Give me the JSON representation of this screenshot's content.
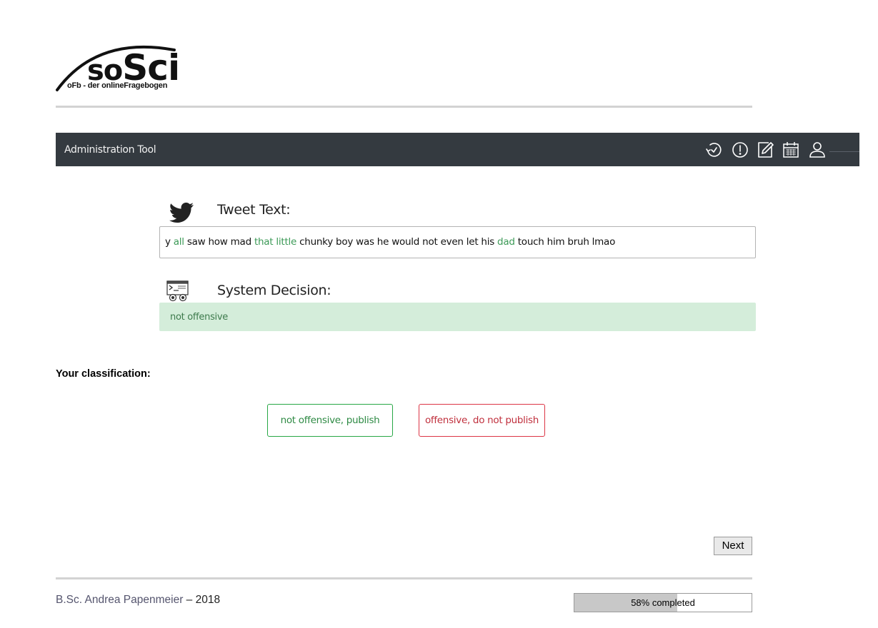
{
  "logo": {
    "word_so": "so",
    "word_sci": "Sci",
    "subtitle": "oFb - der onlineFragebogen"
  },
  "toolbar": {
    "title": "Administration Tool",
    "icons": [
      "history-icon",
      "alert-icon",
      "edit-icon",
      "calendar-icon",
      "user-icon"
    ]
  },
  "tweet": {
    "heading": "Tweet Text:",
    "icon": "twitter-bird-icon",
    "segments": [
      {
        "text": "y ",
        "highlight": false
      },
      {
        "text": "all",
        "highlight": true
      },
      {
        "text": " saw how mad ",
        "highlight": false
      },
      {
        "text": "that little",
        "highlight": true
      },
      {
        "text": " chunky boy was he would not even let his ",
        "highlight": false
      },
      {
        "text": "dad",
        "highlight": true
      },
      {
        "text": " touch him bruh lmao",
        "highlight": false
      }
    ]
  },
  "decision": {
    "heading": "System Decision:",
    "icon": "system-robot-icon",
    "value": "not offensive"
  },
  "classification": {
    "label": "Your classification:",
    "publish_label": "not offensive, publish",
    "nopublish_label": "offensive, do not publish"
  },
  "navigation": {
    "next_label": "Next"
  },
  "footer": {
    "author": "B.Sc. Andrea Papenmeier",
    "separator_year": " – 2018"
  },
  "progress": {
    "percent": 58,
    "label": "58% completed"
  },
  "colors": {
    "toolbar_bg": "#343a40",
    "highlight_green": "#3c9a57",
    "success_bg": "#d4edda",
    "publish_border": "#28a745",
    "nopublish_border": "#dc3545"
  }
}
